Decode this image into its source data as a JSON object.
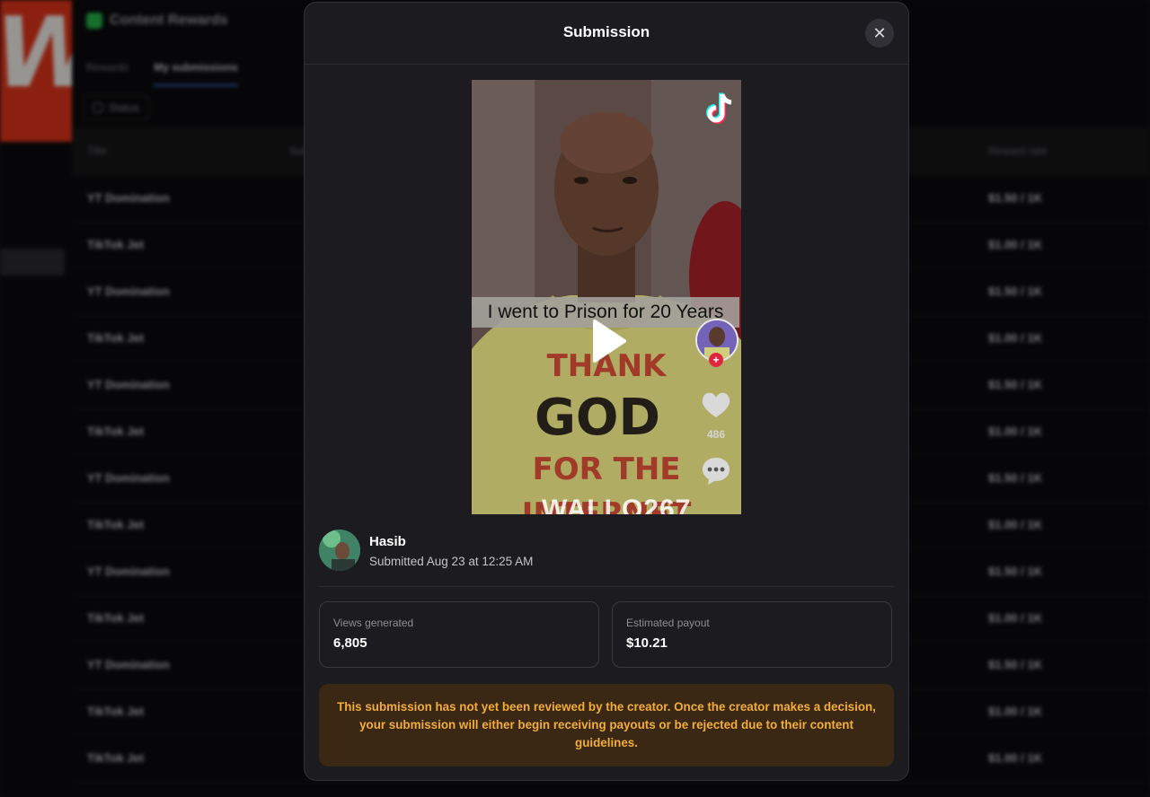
{
  "background": {
    "brand_letter": "W",
    "app_title": "Content Rewards",
    "tabs": [
      {
        "label": "Rewards",
        "active": false
      },
      {
        "label": "My submissions",
        "active": true
      }
    ],
    "filter_label": "Status",
    "table": {
      "columns": [
        "Title",
        "Submitted",
        "Reward rate"
      ],
      "rows": [
        {
          "title": "YT Domination",
          "rate": "$1.50 / 1K"
        },
        {
          "title": "TikTok Jet",
          "rate": "$1.00 / 1K"
        },
        {
          "title": "YT Domination",
          "rate": "$1.50 / 1K"
        },
        {
          "title": "TikTok Jet",
          "rate": "$1.00 / 1K"
        },
        {
          "title": "YT Domination",
          "rate": "$1.50 / 1K"
        },
        {
          "title": "TikTok Jet",
          "rate": "$1.00 / 1K"
        },
        {
          "title": "YT Domination",
          "rate": "$1.50 / 1K"
        },
        {
          "title": "TikTok Jet",
          "rate": "$1.00 / 1K"
        },
        {
          "title": "YT Domination",
          "rate": "$1.50 / 1K"
        },
        {
          "title": "TikTok Jet",
          "rate": "$1.00 / 1K"
        },
        {
          "title": "YT Domination",
          "rate": "$1.50 / 1K"
        },
        {
          "title": "TikTok Jet",
          "rate": "$1.00 / 1K"
        },
        {
          "title": "TikTok Jet",
          "rate": "$1.00 / 1K"
        }
      ]
    }
  },
  "modal": {
    "title": "Submission",
    "close_symbol": "✕",
    "video": {
      "caption": "I went to Prison for 20 Years",
      "shirt_lines": [
        "THANK",
        "GOD",
        "FOR THE",
        "INTERNET"
      ],
      "like_count": "486",
      "watermark": "WALLO267",
      "icons": [
        "tiktok-logo-icon",
        "play-icon",
        "heart-icon",
        "comment-icon"
      ]
    },
    "creator": {
      "name": "Hasib",
      "submitted": "Submitted Aug 23 at 12:25 AM"
    },
    "stats": {
      "views_label": "Views generated",
      "views_value": "6,805",
      "payout_label": "Estimated payout",
      "payout_value": "$10.21"
    },
    "notice": "This submission has not yet been reviewed by the creator. Once the creator makes a decision, your submission will either begin receiving payouts or be rejected due to their content guidelines.",
    "colors": {
      "modal_bg": "#1c1b1f",
      "notice_bg": "#3a2714",
      "notice_text": "#f2ad3c",
      "brand_red": "#e0351a",
      "tab_accent": "#3b6fd8"
    }
  }
}
